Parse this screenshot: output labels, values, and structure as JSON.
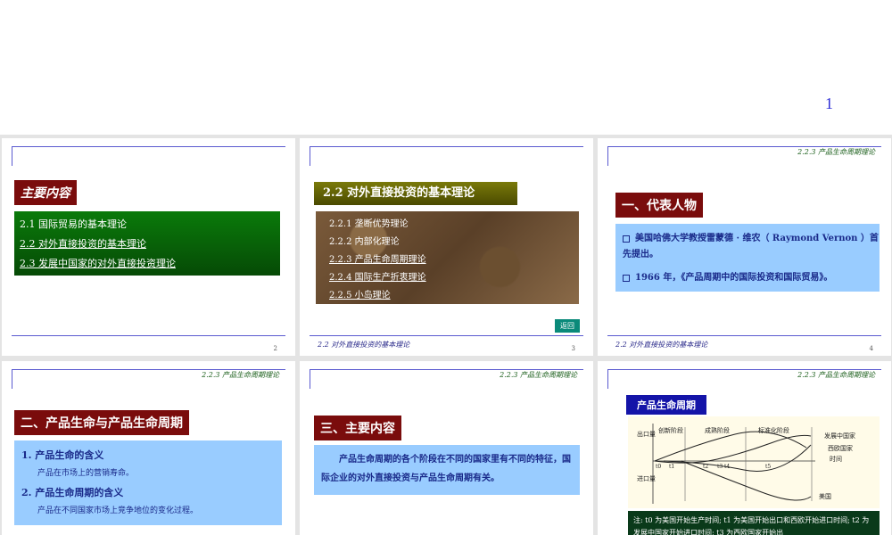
{
  "top_slide": {
    "page_number": "1"
  },
  "slide2": {
    "title": "主要内容",
    "items": [
      "2.1  国际贸易的基本理论",
      "2.2 对外直接投资的基本理论",
      "2.3 发展中国家的对外直接投资理论"
    ],
    "page_number": "2"
  },
  "slide3": {
    "title": "2.2 对外直接投资的基本理论",
    "items": [
      "2.2.1 垄断优势理论",
      "2.2.2 内部化理论",
      "2.2.3 产品生命周期理论",
      "2.2.4 国际生产折衷理论",
      "2.2.5 小岛理论"
    ],
    "return_label": "返回",
    "footer": "2.2  对外直接投资的基本理论",
    "page_number": "3"
  },
  "slide4": {
    "header": "2.2.3  产品生命周期理论",
    "title": "一、代表人物",
    "bullets": [
      "美国哈佛大学教授雷蒙德 · 维农（ Raymond Vernon ）首先提出。",
      "1966 年，《产品周期中的国际投资和国际贸易》。"
    ],
    "footer": "2.2  对外直接投资的基本理论",
    "page_number": "4"
  },
  "slide5": {
    "header": "2.2.3  产品生命周期理论",
    "title": "二、产品生命与产品生命周期",
    "items": [
      {
        "label": "1.  产品生命的含义",
        "desc": "产品在市场上的营销寿命。"
      },
      {
        "label": "2.  产品生命周期的含义",
        "desc": "产品在不同国家市场上竞争地位的变化过程。"
      }
    ]
  },
  "slide6": {
    "header": "2.2.3  产品生命周期理论",
    "title": "三、主要内容",
    "paragraph": "产品生命周期的各个阶段在不同的国家里有不同的特征，国际企业的对外直接投资与产品生命周期有关。"
  },
  "slide7": {
    "header": "2.2.3  产品生命周期理论",
    "title": "产品生命周期",
    "chart": {
      "y_top_label": "出口量",
      "y_bottom_label": "进口量",
      "phases": [
        "创新阶段",
        "成熟阶段",
        "标准化阶段"
      ],
      "series_labels": [
        "发展中国家",
        "西欧国家",
        "时间",
        "美国"
      ],
      "time_marks": [
        "t0",
        "t1",
        "t2",
        "t3",
        "t4",
        "t5"
      ]
    },
    "note": "注:  t0 为美国开始生产时间;  t1 为美国开始出口和西欧开始进口时间;  t2 为发展中国家开始进口时间;  t3 为西欧国家开始出"
  },
  "colors": {
    "title_red": "#7a0c0c",
    "green": "#0a7a0a",
    "light_blue": "#99ccff",
    "navy": "#1414a8"
  }
}
